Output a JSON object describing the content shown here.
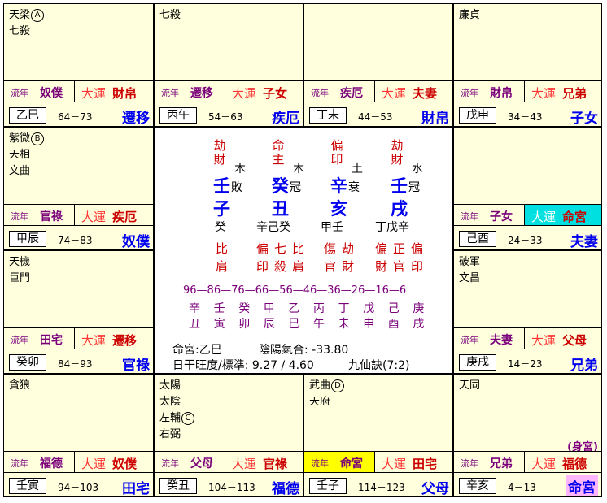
{
  "liunian_tag": "流年",
  "dayun_tag": "大運",
  "shen_gong": "(身宮)",
  "palaces": {
    "si": {
      "stars": [
        "天梁",
        "七殺"
      ],
      "circle": "A",
      "liunian": "奴僕",
      "dayun": "財帛",
      "ganzhi": "乙巳",
      "age": "64－73",
      "name": "遷移"
    },
    "wu": {
      "stars": [
        "七殺"
      ],
      "liunian": "遷移",
      "dayun": "子女",
      "ganzhi": "丙午",
      "age": "54－63",
      "name": "疾厄"
    },
    "wei": {
      "stars": [],
      "liunian": "疾厄",
      "dayun": "夫妻",
      "ganzhi": "丁未",
      "age": "44－53",
      "name": "財帛"
    },
    "shen": {
      "stars": [
        "廉貞"
      ],
      "liunian": "財帛",
      "dayun": "兄弟",
      "ganzhi": "戊申",
      "age": "34－43",
      "name": "子女"
    },
    "chen": {
      "stars": [
        "紫微",
        "天相",
        "文曲"
      ],
      "circle": "B",
      "liunian": "官祿",
      "dayun": "疾厄",
      "ganzhi": "甲辰",
      "age": "74－83",
      "name": "奴僕"
    },
    "you": {
      "stars": [],
      "liunian": "子女",
      "dayun": "命宮",
      "ganzhi": "己酉",
      "age": "24－33",
      "name": "夫妻"
    },
    "mao": {
      "stars": [
        "天機",
        "巨門"
      ],
      "liunian": "田宅",
      "dayun": "遷移",
      "ganzhi": "癸卯",
      "age": "84－93",
      "name": "官祿"
    },
    "xu": {
      "stars": [
        "破軍",
        "文昌"
      ],
      "liunian": "夫妻",
      "dayun": "父母",
      "ganzhi": "庚戌",
      "age": "14－23",
      "name": "兄弟"
    },
    "yin": {
      "stars": [
        "貪狼"
      ],
      "liunian": "福德",
      "dayun": "奴僕",
      "ganzhi": "壬寅",
      "age": "94－103",
      "name": "田宅"
    },
    "chou": {
      "stars": [
        "太陽",
        "太陰",
        "左輔",
        "右弼"
      ],
      "circle": "C",
      "liunian": "父母",
      "dayun": "官祿",
      "ganzhi": "癸丑",
      "age": "104－113",
      "name": "福德"
    },
    "zi": {
      "stars": [
        "武曲",
        "天府"
      ],
      "circle": "D",
      "liunian": "命宮",
      "dayun": "田宅",
      "ganzhi": "壬子",
      "age": "114－123",
      "name": "父母"
    },
    "hai": {
      "stars": [
        "天同"
      ],
      "liunian": "兄弟",
      "dayun": "福德",
      "ganzhi": "辛亥",
      "age": "4－13",
      "name": "命宮"
    }
  },
  "center": {
    "pillars": [
      {
        "star": "劫財",
        "element": "木",
        "stem": "壬",
        "phase": "敗",
        "branch": "子",
        "hidden": "癸",
        "gods": "比肩"
      },
      {
        "star": "命主",
        "element": "木",
        "stem": "癸",
        "phase": "冠",
        "branch": "丑",
        "hidden": "辛己癸",
        "gods": "偏印七殺比肩"
      },
      {
        "star": "偏印",
        "element": "土",
        "stem": "辛",
        "phase": "衰",
        "branch": "亥",
        "hidden": "甲壬",
        "gods": "傷官劫財"
      },
      {
        "star": "劫財",
        "element": "水",
        "stem": "壬",
        "phase": "冠",
        "branch": "戌",
        "hidden": "丁戊辛",
        "gods": "偏財正官偏印"
      }
    ],
    "decades": "96—86—76—66—56—46—36—26—16—6",
    "decade_stems": [
      "辛",
      "壬",
      "癸",
      "甲",
      "乙",
      "丙",
      "丁",
      "戊",
      "己",
      "庚"
    ],
    "decade_branches": [
      "丑",
      "寅",
      "卯",
      "辰",
      "巳",
      "午",
      "未",
      "申",
      "酉",
      "戌"
    ],
    "ming_gong": "命宮:乙巳",
    "yinyang": "陰陽氣合: -33.80",
    "wangdu": "日干旺度/標準: 9.27 / 4.60",
    "jiuxian": "九仙訣(7:2)"
  }
}
